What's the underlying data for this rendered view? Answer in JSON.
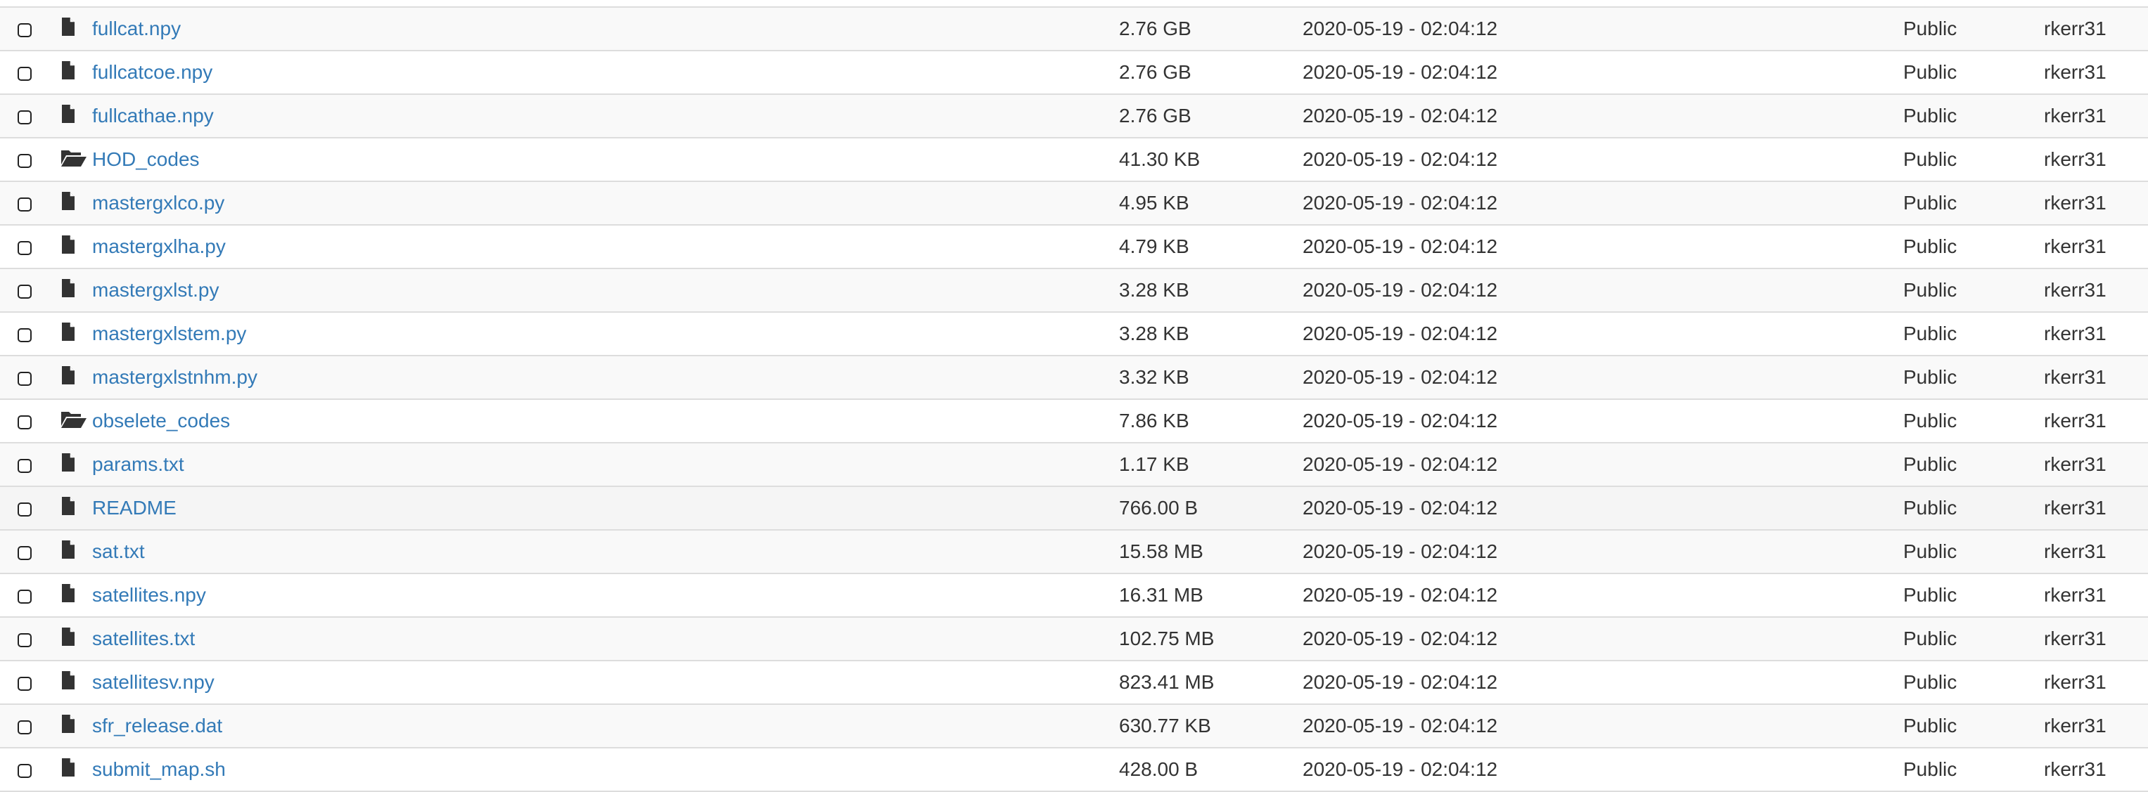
{
  "colors": {
    "link": "#337ab7",
    "text": "#333333",
    "border": "#dddddd",
    "stripe": "#f9f9f9"
  },
  "rows": [
    {
      "name": "fullcat.npy",
      "icon": "file-icon",
      "size": "2.76 GB",
      "modified": "2020-05-19 - 02:04:12",
      "access": "Public",
      "owner": "rkerr31"
    },
    {
      "name": "fullcatcoe.npy",
      "icon": "file-icon",
      "size": "2.76 GB",
      "modified": "2020-05-19 - 02:04:12",
      "access": "Public",
      "owner": "rkerr31"
    },
    {
      "name": "fullcathae.npy",
      "icon": "file-icon",
      "size": "2.76 GB",
      "modified": "2020-05-19 - 02:04:12",
      "access": "Public",
      "owner": "rkerr31"
    },
    {
      "name": "HOD_codes",
      "icon": "folder-open-icon",
      "size": "41.30 KB",
      "modified": "2020-05-19 - 02:04:12",
      "access": "Public",
      "owner": "rkerr31"
    },
    {
      "name": "mastergxlco.py",
      "icon": "file-icon",
      "size": "4.95 KB",
      "modified": "2020-05-19 - 02:04:12",
      "access": "Public",
      "owner": "rkerr31"
    },
    {
      "name": "mastergxlha.py",
      "icon": "file-icon",
      "size": "4.79 KB",
      "modified": "2020-05-19 - 02:04:12",
      "access": "Public",
      "owner": "rkerr31"
    },
    {
      "name": "mastergxlst.py",
      "icon": "file-icon",
      "size": "3.28 KB",
      "modified": "2020-05-19 - 02:04:12",
      "access": "Public",
      "owner": "rkerr31"
    },
    {
      "name": "mastergxlstem.py",
      "icon": "file-icon",
      "size": "3.28 KB",
      "modified": "2020-05-19 - 02:04:12",
      "access": "Public",
      "owner": "rkerr31"
    },
    {
      "name": "mastergxlstnhm.py",
      "icon": "file-icon",
      "size": "3.32 KB",
      "modified": "2020-05-19 - 02:04:12",
      "access": "Public",
      "owner": "rkerr31"
    },
    {
      "name": "obselete_codes",
      "icon": "folder-open-icon",
      "size": "7.86 KB",
      "modified": "2020-05-19 - 02:04:12",
      "access": "Public",
      "owner": "rkerr31"
    },
    {
      "name": "params.txt",
      "icon": "file-icon",
      "size": "1.17 KB",
      "modified": "2020-05-19 - 02:04:12",
      "access": "Public",
      "owner": "rkerr31"
    },
    {
      "name": "README",
      "icon": "file-icon",
      "size": "766.00 B",
      "modified": "2020-05-19 - 02:04:12",
      "access": "Public",
      "owner": "rkerr31"
    },
    {
      "name": "sat.txt",
      "icon": "file-icon",
      "size": "15.58 MB",
      "modified": "2020-05-19 - 02:04:12",
      "access": "Public",
      "owner": "rkerr31"
    },
    {
      "name": "satellites.npy",
      "icon": "file-icon",
      "size": "16.31 MB",
      "modified": "2020-05-19 - 02:04:12",
      "access": "Public",
      "owner": "rkerr31"
    },
    {
      "name": "satellites.txt",
      "icon": "file-icon",
      "size": "102.75 MB",
      "modified": "2020-05-19 - 02:04:12",
      "access": "Public",
      "owner": "rkerr31"
    },
    {
      "name": "satellitesv.npy",
      "icon": "file-icon",
      "size": "823.41 MB",
      "modified": "2020-05-19 - 02:04:12",
      "access": "Public",
      "owner": "rkerr31"
    },
    {
      "name": "sfr_release.dat",
      "icon": "file-icon",
      "size": "630.77 KB",
      "modified": "2020-05-19 - 02:04:12",
      "access": "Public",
      "owner": "rkerr31"
    },
    {
      "name": "submit_map.sh",
      "icon": "file-icon",
      "size": "428.00 B",
      "modified": "2020-05-19 - 02:04:12",
      "access": "Public",
      "owner": "rkerr31"
    }
  ]
}
